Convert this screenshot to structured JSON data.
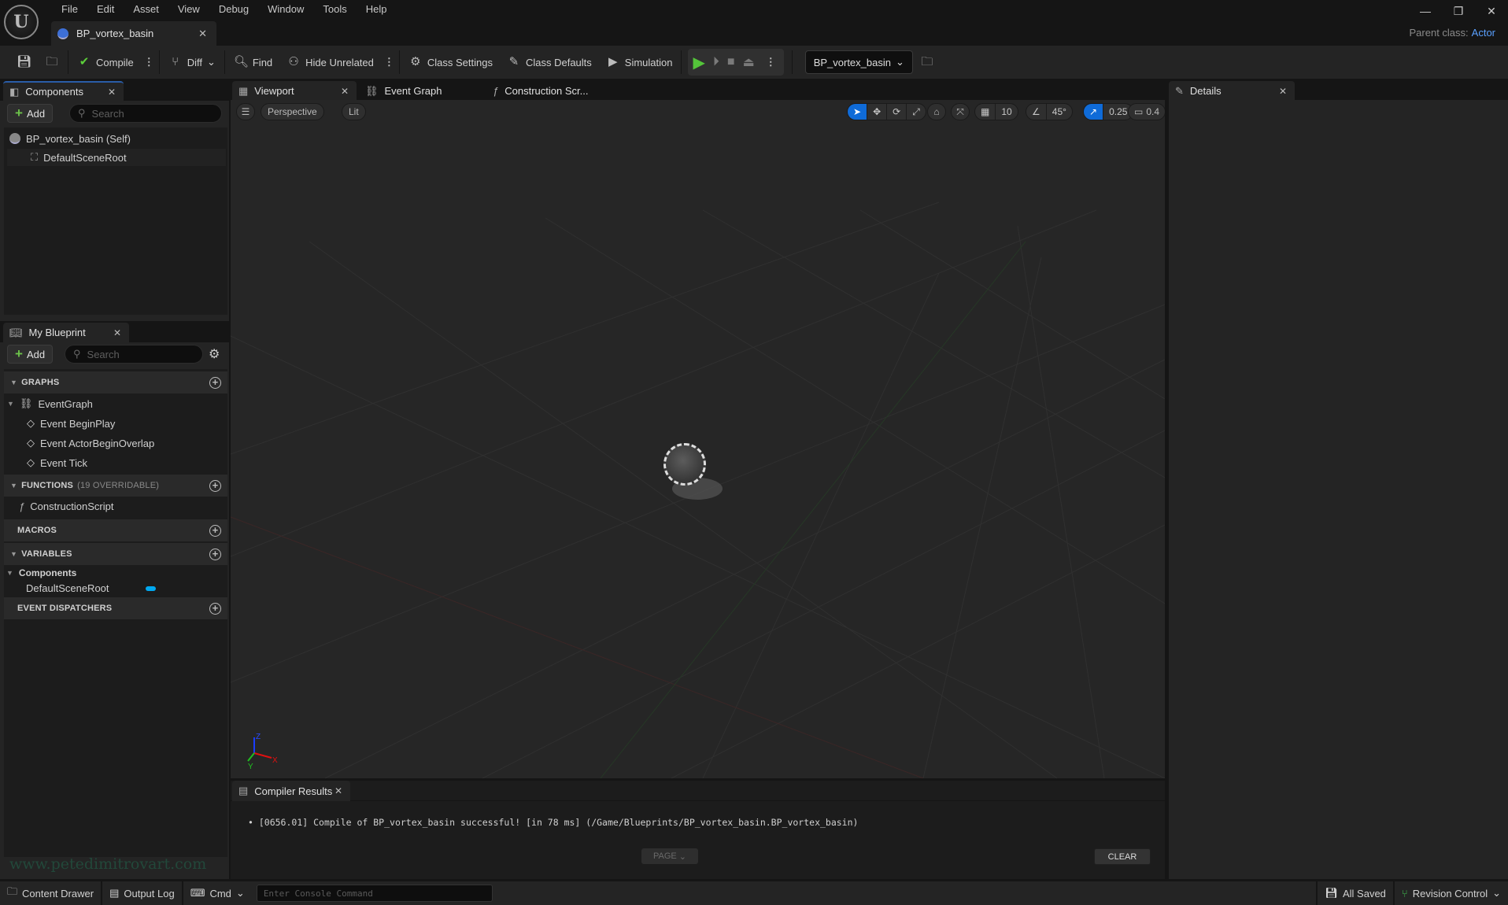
{
  "app": {
    "document_tab": "BP_vortex_basin",
    "parent_class_label": "Parent class:",
    "parent_class_value": "Actor",
    "menu": [
      "File",
      "Edit",
      "Asset",
      "View",
      "Debug",
      "Window",
      "Tools",
      "Help"
    ],
    "window_controls": {
      "minimize": "—",
      "restore": "❐",
      "close": "✕"
    }
  },
  "toolbar": {
    "compile": "Compile",
    "diff": "Diff",
    "find": "Find",
    "hide_unrelated": "Hide Unrelated",
    "class_settings": "Class Settings",
    "class_defaults": "Class Defaults",
    "simulation": "Simulation",
    "debug_object": "BP_vortex_basin"
  },
  "components_panel": {
    "tab": "Components",
    "add": "Add",
    "search_placeholder": "Search",
    "items": [
      "BP_vortex_basin (Self)",
      "DefaultSceneRoot"
    ]
  },
  "my_blueprint": {
    "tab": "My Blueprint",
    "add": "Add",
    "search_placeholder": "Search",
    "graphs": {
      "title": "GRAPHS",
      "event_graph": "EventGraph",
      "events": [
        "Event BeginPlay",
        "Event ActorBeginOverlap",
        "Event Tick"
      ]
    },
    "functions": {
      "title": "FUNCTIONS",
      "sub": "(19 OVERRIDABLE)",
      "items": [
        "ConstructionScript"
      ]
    },
    "macros": {
      "title": "MACROS"
    },
    "variables": {
      "title": "VARIABLES",
      "category": "Components",
      "items": [
        "DefaultSceneRoot"
      ],
      "type_color": "#00a8f0"
    },
    "dispatchers": {
      "title": "EVENT DISPATCHERS"
    }
  },
  "editor_tabs": [
    "Viewport",
    "Event Graph",
    "Construction Scr..."
  ],
  "viewport": {
    "view_mode": "Perspective",
    "lighting": "Lit",
    "grid_snap": "10",
    "rotation_snap": "45°",
    "scale_snap": "0.25",
    "camera_speed": "0.4",
    "axes": {
      "x": "X",
      "y": "Y",
      "z": "Z"
    }
  },
  "details": {
    "tab": "Details"
  },
  "compiler": {
    "tab": "Compiler Results",
    "message": "[0656.01] Compile of BP_vortex_basin successful! [in 78 ms] (/Game/Blueprints/BP_vortex_basin.BP_vortex_basin)",
    "page": "PAGE",
    "clear": "CLEAR"
  },
  "statusbar": {
    "content_drawer": "Content Drawer",
    "output_log": "Output Log",
    "cmd": "Cmd",
    "console_placeholder": "Enter Console Command",
    "all_saved": "All Saved",
    "revision_control": "Revision Control"
  },
  "watermark": "www.petedimitrovart.com"
}
